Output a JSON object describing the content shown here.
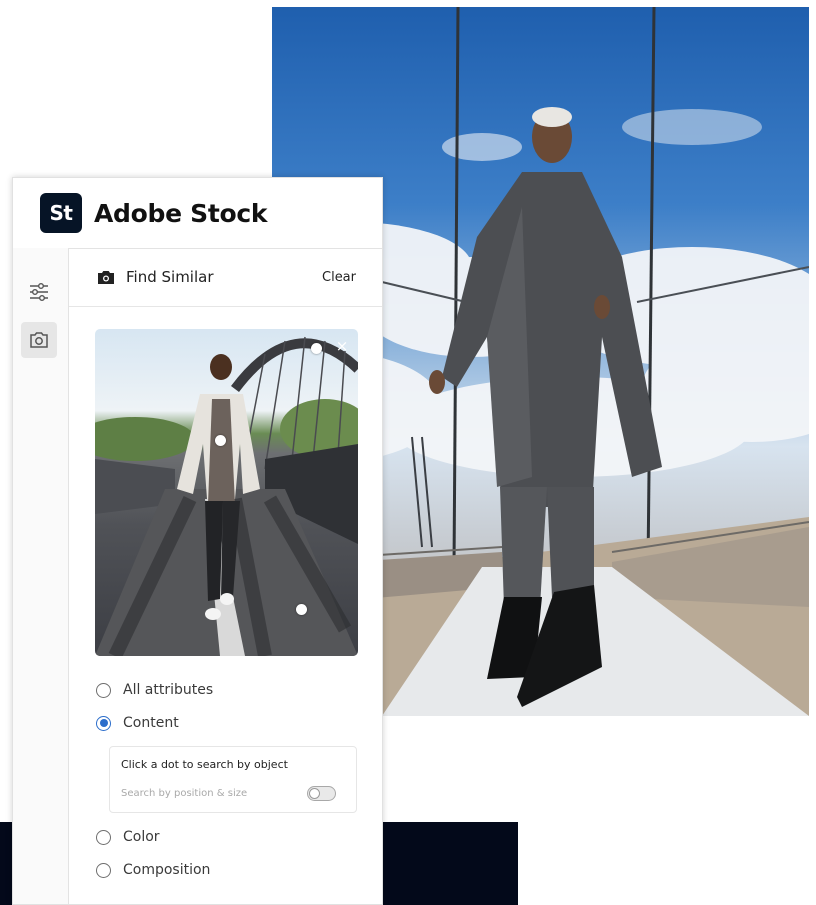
{
  "brand": {
    "logo_text": "St",
    "name": "Adobe Stock"
  },
  "sidebar": {
    "items": [
      {
        "icon": "sliders-icon"
      },
      {
        "icon": "camera-icon",
        "active": true
      }
    ]
  },
  "find_similar": {
    "title": "Find Similar",
    "clear_label": "Clear",
    "options": [
      {
        "label": "All attributes",
        "checked": false
      },
      {
        "label": "Content",
        "checked": true
      },
      {
        "label": "Color",
        "checked": false
      },
      {
        "label": "Composition",
        "checked": false
      }
    ],
    "object_search": {
      "title": "Click a dot to search by object",
      "toggle_label": "Search by position & size",
      "toggle_on": false
    }
  },
  "colors": {
    "accent": "#2c6ecb",
    "logo_bg": "#061426",
    "dark_band": "#03091a"
  }
}
